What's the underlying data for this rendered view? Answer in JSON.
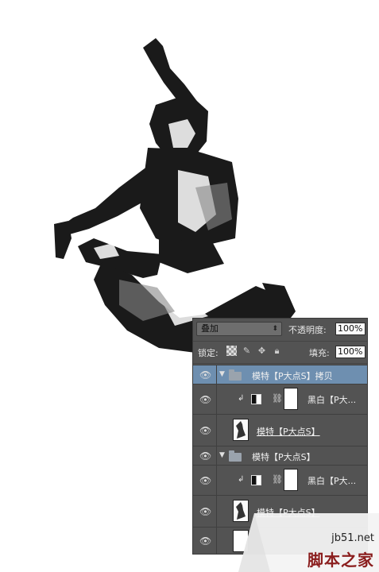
{
  "panel": {
    "blend_mode": "叠加",
    "opacity_label": "不透明度:",
    "opacity_value": "100%",
    "lock_label": "锁定:",
    "fill_label": "填充:",
    "fill_value": "100%"
  },
  "layers": [
    {
      "name": "模特【P大点S】拷贝"
    },
    {
      "name": "黑白【P大..."
    },
    {
      "name": "模特【P大点S】"
    },
    {
      "name": "模特【P大点S】"
    },
    {
      "name": "黑白【P大..."
    },
    {
      "name": "模特【P大点S】"
    }
  ],
  "watermark": {
    "site": "jb51.net",
    "name": "脚本之家"
  },
  "colors": {
    "panel_bg": "#535353",
    "selected_row": "#6e8fb0",
    "watermark_red": "#8a1d1d"
  }
}
